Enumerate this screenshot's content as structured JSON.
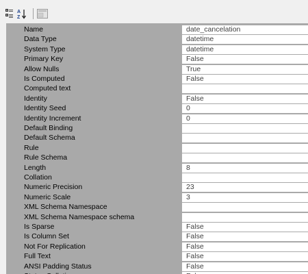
{
  "toolbar": {
    "buttons": [
      {
        "name": "categorized-icon"
      },
      {
        "name": "alphabetical-sort-icon"
      },
      {
        "name": "property-pages-icon"
      }
    ]
  },
  "properties": [
    {
      "name": "Name",
      "value": "date_cancelation"
    },
    {
      "name": "Data Type",
      "value": "datetime"
    },
    {
      "name": "System Type",
      "value": "datetime"
    },
    {
      "name": "Primary Key",
      "value": "False"
    },
    {
      "name": "Allow Nulls",
      "value": "True"
    },
    {
      "name": "Is Computed",
      "value": "False"
    },
    {
      "name": "Computed text",
      "value": ""
    },
    {
      "name": "Identity",
      "value": "False"
    },
    {
      "name": "Identity Seed",
      "value": "0"
    },
    {
      "name": "Identity Increment",
      "value": "0"
    },
    {
      "name": "Default Binding",
      "value": ""
    },
    {
      "name": "Default Schema",
      "value": ""
    },
    {
      "name": "Rule",
      "value": ""
    },
    {
      "name": "Rule Schema",
      "value": ""
    },
    {
      "name": "Length",
      "value": "8"
    },
    {
      "name": "Collation",
      "value": ""
    },
    {
      "name": "Numeric Precision",
      "value": "23"
    },
    {
      "name": "Numeric Scale",
      "value": "3"
    },
    {
      "name": "XML Schema Namespace",
      "value": ""
    },
    {
      "name": "XML Schema Namespace schema",
      "value": ""
    },
    {
      "name": "Is Sparse",
      "value": "False"
    },
    {
      "name": "Is Column Set",
      "value": "False"
    },
    {
      "name": "Not For Replication",
      "value": "False"
    },
    {
      "name": "Full Text",
      "value": "False"
    },
    {
      "name": "ANSI Padding Status",
      "value": "False"
    },
    {
      "name": "Status Collation",
      "value": "False"
    }
  ],
  "colors": {
    "name_cell": "#a9a9a9",
    "value_cell": "#ffffff",
    "grid_line": "#ababab"
  }
}
